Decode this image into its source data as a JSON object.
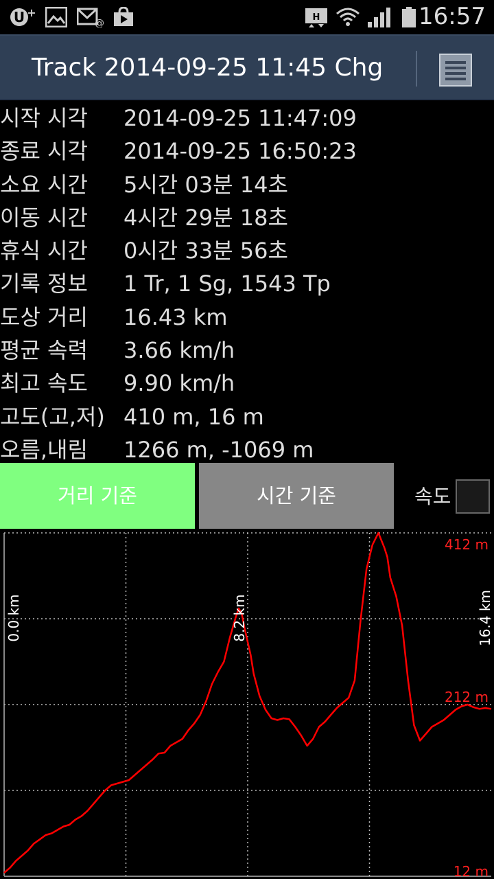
{
  "status_bar": {
    "time": "16:57",
    "icons": [
      "u-plus-icon",
      "image-icon",
      "email-icon",
      "store-icon",
      "data-sync-icon",
      "wifi-icon",
      "signal-icon",
      "battery-icon"
    ]
  },
  "action_bar": {
    "title": "Track 2014-09-25 11:45 Chg",
    "menu_icon": "menu-icon"
  },
  "info_rows": [
    {
      "label": "시작 시각",
      "value": "2014-09-25 11:47:09"
    },
    {
      "label": "종료 시각",
      "value": "2014-09-25 16:50:23"
    },
    {
      "label": "소요 시간",
      "value": "5시간 03분 14초"
    },
    {
      "label": "이동 시간",
      "value": "4시간 29분 18초"
    },
    {
      "label": "휴식 시간",
      "value": "0시간 33분 56초"
    },
    {
      "label": "기록 정보",
      "value": "1 Tr, 1 Sg, 1543 Tp"
    },
    {
      "label": "도상 거리",
      "value": "16.43 km"
    },
    {
      "label": "평균 속력",
      "value": "3.66 km/h"
    },
    {
      "label": "최고 속도",
      "value": "9.90 km/h"
    },
    {
      "label": "고도(고,저)",
      "value": "410 m, 16 m"
    },
    {
      "label": "오름,내림",
      "value": "1266 m, -1069 m"
    }
  ],
  "buttons": {
    "distance": "거리 기준",
    "time": "시간 기준",
    "speed_label": "속도"
  },
  "colors": {
    "action_bar": "#2f3f55",
    "distance_button": "#80ff80",
    "time_button": "#878787",
    "line": "#ff0000"
  },
  "chart_data": {
    "type": "line",
    "x_labels": [
      "0.0 km",
      "8.2 km",
      "16.4 km"
    ],
    "y_labels": [
      "412 m",
      "212 m",
      "12 m"
    ],
    "xlim": [
      0,
      16.4
    ],
    "ylim": [
      12,
      412
    ],
    "grid": true,
    "series": [
      {
        "x": [
          0.0,
          0.2,
          0.4,
          0.6,
          0.8,
          1.0,
          1.2,
          1.4,
          1.6,
          1.8,
          2.0,
          2.2,
          2.4,
          2.6,
          2.8,
          3.0,
          3.2,
          3.4,
          3.6,
          3.8,
          4.0,
          4.2,
          4.4,
          4.6,
          4.8,
          5.0,
          5.2,
          5.4,
          5.6,
          5.8,
          6.0,
          6.2,
          6.4,
          6.6,
          6.8,
          7.0,
          7.2,
          7.4,
          7.6,
          7.8,
          7.9,
          8.0,
          8.1,
          8.2,
          8.3,
          8.4,
          8.6,
          8.8,
          9.0,
          9.2,
          9.4,
          9.6,
          9.8,
          10.0,
          10.2,
          10.4,
          10.6,
          10.8,
          11.0,
          11.2,
          11.4,
          11.6,
          11.8,
          12.0,
          12.2,
          12.4,
          12.6,
          12.8,
          12.9,
          13.0,
          13.2,
          13.4,
          13.6,
          13.8,
          14.0,
          14.2,
          14.4,
          14.6,
          14.8,
          15.0,
          15.2,
          15.4,
          15.6,
          15.8,
          16.0,
          16.2,
          16.4
        ],
        "y": [
          16,
          22,
          30,
          36,
          42,
          50,
          55,
          60,
          62,
          66,
          70,
          72,
          78,
          82,
          88,
          96,
          104,
          112,
          118,
          120,
          122,
          124,
          130,
          136,
          142,
          148,
          155,
          156,
          164,
          168,
          172,
          182,
          190,
          200,
          216,
          236,
          250,
          262,
          290,
          314,
          324,
          318,
          300,
          285,
          270,
          248,
          222,
          206,
          196,
          194,
          196,
          195,
          186,
          176,
          164,
          172,
          186,
          192,
          200,
          208,
          214,
          220,
          240,
          310,
          370,
          398,
          412,
          395,
          384,
          360,
          338,
          304,
          240,
          188,
          170,
          178,
          186,
          190,
          194,
          200,
          206,
          210,
          212,
          209,
          207,
          208,
          207
        ]
      }
    ]
  }
}
